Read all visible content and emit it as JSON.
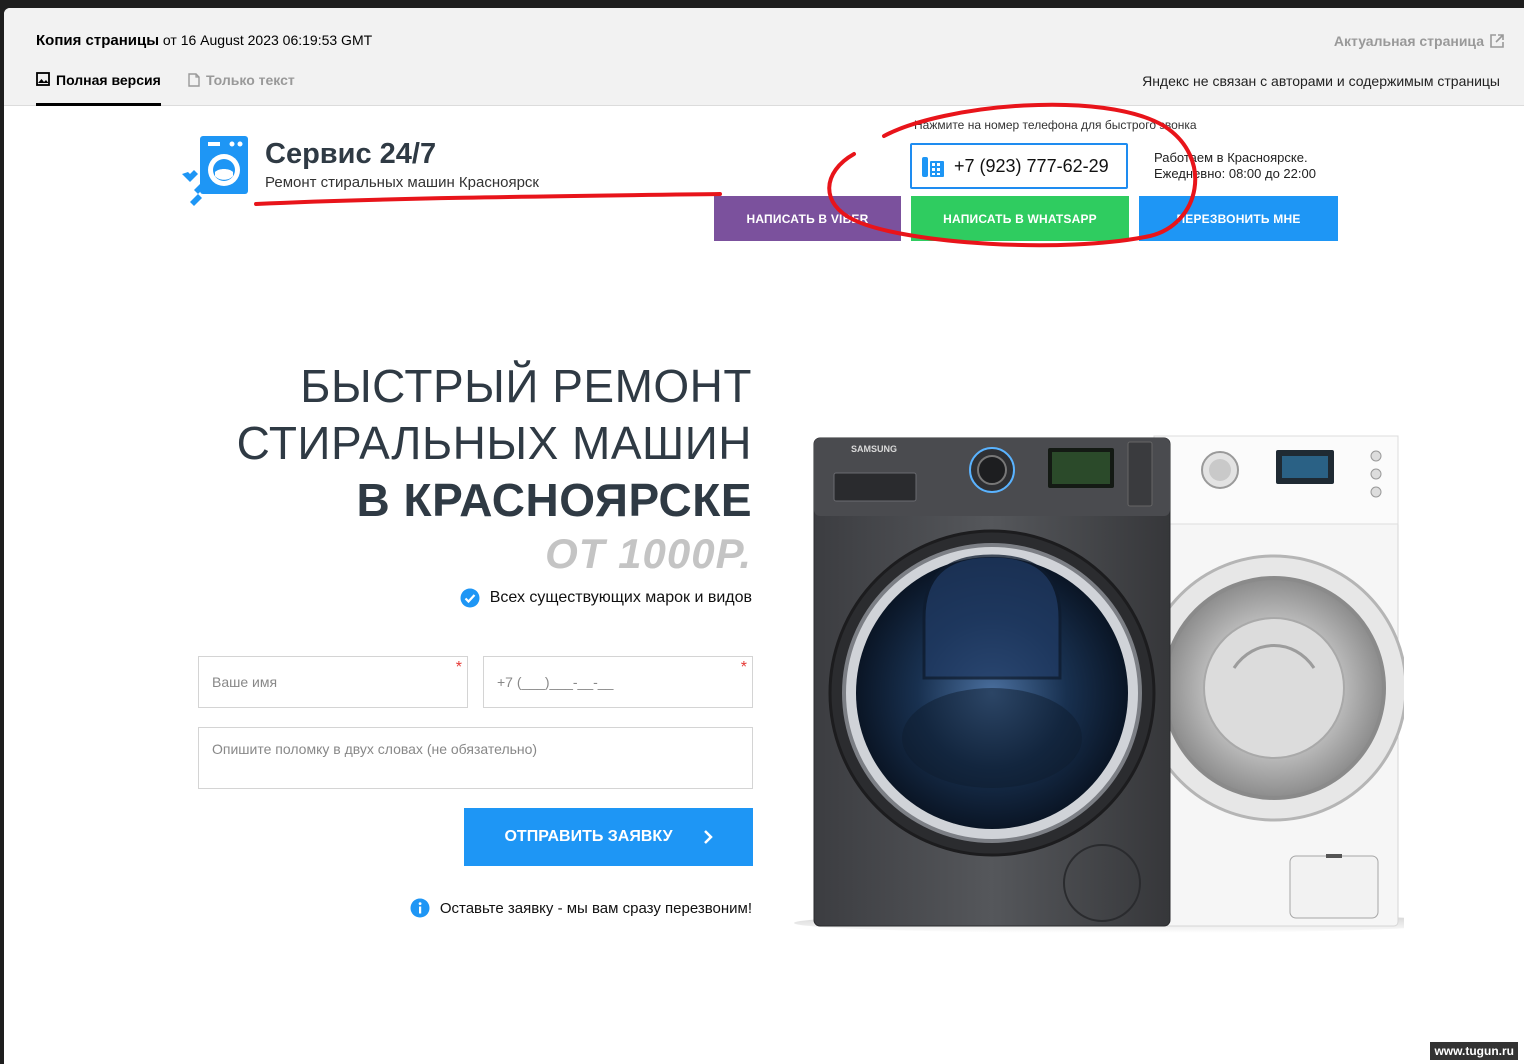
{
  "cache_bar": {
    "title_bold": "Копия страницы",
    "title_rest": " от 16 August 2023 06:19:53 GMT",
    "actual_page": "Актуальная страница",
    "tab_full": "Полная версия",
    "tab_text": "Только текст",
    "disclaimer": "Яндекс не связан с авторами и содержимым страницы"
  },
  "header": {
    "brand_name": "Сервис 24/7",
    "brand_sub": "Ремонт стиральных машин Красноярск",
    "call_hint": "Нажмите на номер телефона для быстрого звонка",
    "phone": "+7 (923) 777-62-29",
    "hours_line1": "Работаем в Красноярске.",
    "hours_line2": "Ежедневно: 08:00 до 22:00",
    "btn_viber": "Написать в Viber",
    "btn_whatsapp": "Написать в WhatsApp",
    "btn_callback": "Перезвонить мне"
  },
  "hero": {
    "line1": "БЫСТРЫЙ РЕМОНТ",
    "line2": "СТИРАЛЬНЫХ МАШИН",
    "line3": "В КРАСНОЯРСКЕ",
    "price": "ОТ 1000Р.",
    "brands": "Всех существующих марок и видов"
  },
  "form": {
    "name_placeholder": "Ваше имя",
    "phone_placeholder": "+7 (___)___-__-__",
    "desc_placeholder": "Опишите поломку в двух словах (не обязательно)",
    "required_mark": "*",
    "submit": "ОТПРАВИТЬ ЗАЯВКУ",
    "info": "Оставьте заявку - мы вам сразу перезвоним!"
  },
  "machine": {
    "brand": "SAMSUNG"
  },
  "watermark": "www.tugun.ru",
  "colors": {
    "accent_blue": "#1e96f5",
    "viber": "#7b519d",
    "whatsapp": "#2fcc60",
    "annotation_red": "#e8141a"
  }
}
